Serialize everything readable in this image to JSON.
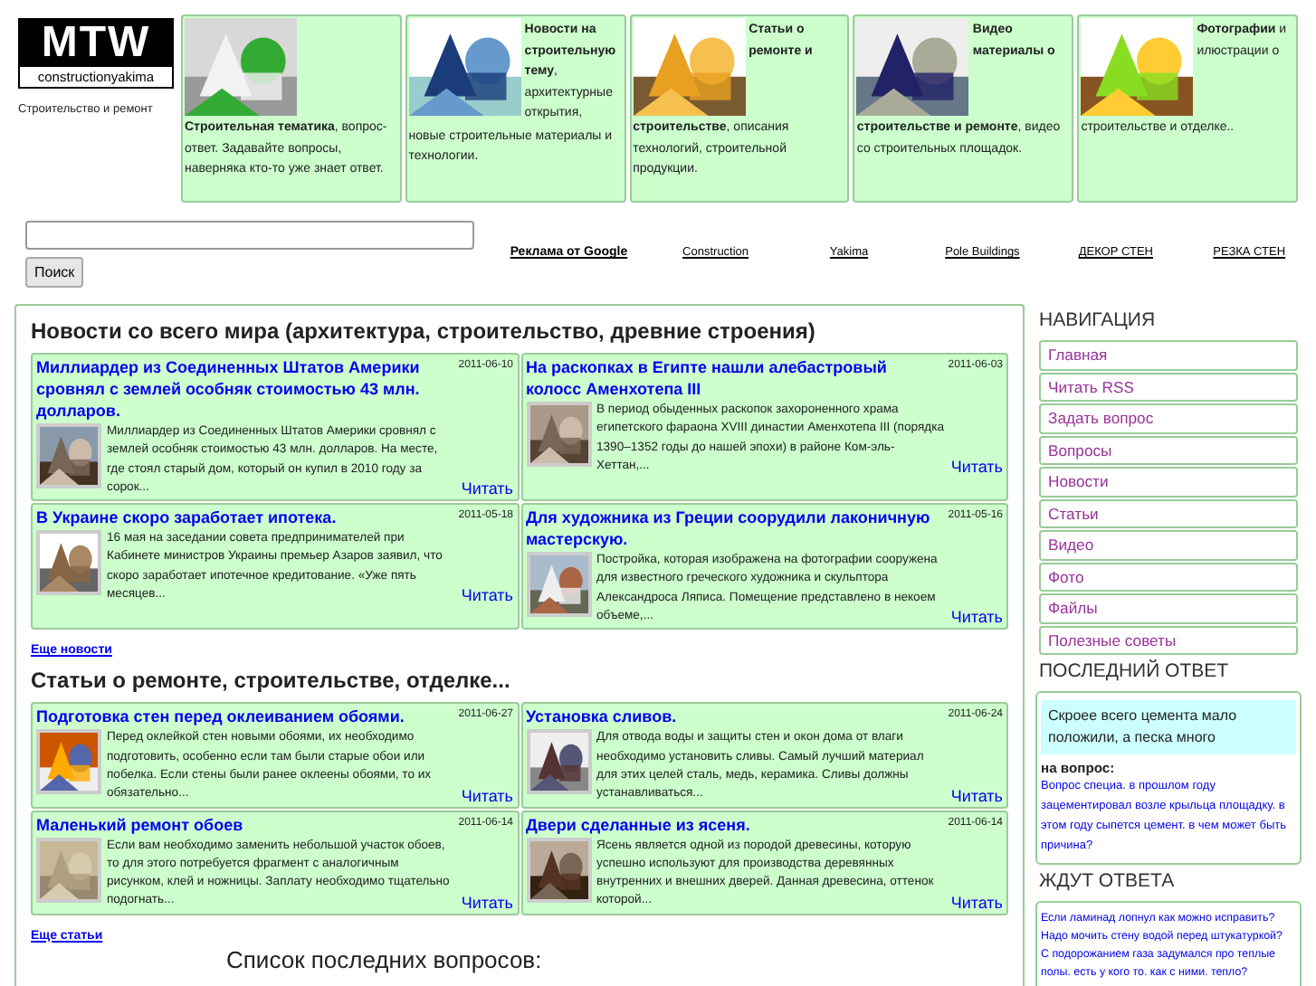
{
  "logo": {
    "mark": "MTW",
    "subtitle": "constructionyakima",
    "tagline": "Строительство и ремонт"
  },
  "tiles": [
    {
      "text": "**Строительная тематика**, вопрос-ответ. Задавайте вопросы, наверняка кто-то уже знает ответ."
    },
    {
      "head": "**Новости на строительную тему**, архитектурные открытия,",
      "text": "новые строительные материалы и технологии."
    },
    {
      "head": "**Статьи о ремонте и**",
      "text": "**строительстве**, описания технологий, строительной продукции."
    },
    {
      "head": "**Видео материалы о**",
      "text": "**строительстве и ремонте**, видео со строительных площадок."
    },
    {
      "head": "**Фотографии** и илюстрации о",
      "text": "строительстве и отделке.."
    }
  ],
  "search": {
    "button": "Поиск"
  },
  "ads": {
    "title": "Реклама от Google",
    "links": [
      "Construction",
      "Yakima",
      "Pole Buildings",
      "ДЕКОР СТЕН",
      "РЕЗКА СТЕН"
    ]
  },
  "sections": [
    {
      "heading": "Новости со всего мира (архитектура, строительство, древние строения)",
      "more": "Еще новости",
      "cards": [
        {
          "title": "Миллиардер из Соединенных Штатов Америки сровнял с землей особняк стоимостью 43 млн. долларов.",
          "date": "2011-06-10",
          "text": "Миллиардер из Соединенных Штатов Америки сровнял с землей особняк стоимостью 43 млн. долларов. На месте, где стоял старый дом, который он купил в 2010 году за сорок...",
          "read": "Читать"
        },
        {
          "title": "На раскопках в Египте нашли алебастровый колосс Аменхотепа III",
          "date": "2011-06-03",
          "text": "В период обыденных раскопок захороненного храма египетского фараона XVIII династии Аменхотепа III (порядка 1390–1352 годы до нашей эпохи) в районе Ком-эль-Хеттан,...",
          "read": "Читать"
        },
        {
          "title": "В Украине скоро заработает ипотека.",
          "date": "2011-05-18",
          "text": "16 мая на заседании совета предпринимателей при Кабинете министров Украины премьер Азаров заявил, что скоро заработает ипотечное кредитование. «Уже пять месяцев...",
          "read": "Читать"
        },
        {
          "title": "Для художника из Греции соорудили лаконичную мастерскую.",
          "date": "2011-05-16",
          "text": "Постройка, которая изображена на фотографии сооружена для известного греческого художника и скульптора Александроса Ляписа. Помещение представлено в некоем объеме,...",
          "read": "Читать"
        }
      ]
    },
    {
      "heading": "Статьи о ремонте, строительстве, отделке...",
      "more": "Еще статьи",
      "cards": [
        {
          "title": "Подготовка стен перед оклеиванием обоями.",
          "date": "2011-06-27",
          "text": "Перед оклейкой стен новыми обоями, их необходимо подготовить, особенно если там были старые обои или побелка. Если стены были ранее оклеены обоями, то их обязательно...",
          "read": "Читать"
        },
        {
          "title": "Установка сливов.",
          "date": "2011-06-24",
          "text": "Для отвода воды и защиты стен и окон дома от влаги необходимо установить сливы. Самый лучший материал для этих целей сталь, медь, керамика. Сливы должны устанавливаться...",
          "read": "Читать"
        },
        {
          "title": "Маленький ремонт обоев",
          "date": "2011-06-14",
          "text": "Если вам необходимо заменить небольшой участок обоев, то для этого потребуется фрагмент с аналогичным рисунком, клей и ножницы. Заплату необходимо тщательно подогнать...",
          "read": "Читать"
        },
        {
          "title": "Двери сделанные из ясеня.",
          "date": "2011-06-14",
          "text": "Ясень является одной из породой древесины, которую успешно используют для производства деревянных внутренних и внешних дверей. Данная древесина, оттенок которой...",
          "read": "Читать"
        }
      ]
    }
  ],
  "questions_heading": "Список последних вопросов:",
  "sidebar": {
    "nav_title": "НАВИГАЦИЯ",
    "nav": [
      "Главная",
      "Читать RSS",
      "Задать вопрос",
      "Вопросы",
      "Новости",
      "Статьи",
      "Видео",
      "Фото",
      "Файлы",
      "Полезные советы"
    ],
    "last_title": "ПОСЛЕДНИЙ ОТВЕТ",
    "answer": "Скроее всего цемента мало положили, а песка много",
    "question_label": "на вопрос:",
    "question": "Вопрос специа. в прошлом году зацементировал возле крыльца площадку. в этом году сыпется цемент. в чем может быть причина?",
    "wait_title": "ЖДУТ ОТВЕТА",
    "waiting": [
      "Если ламинад лопнул как можно исправить?",
      "Надо мочить стену водой перед штукатуркой?",
      "С подорожанием газа задумался про теплые полы. есть у кого то. как с ними. тепло?"
    ]
  }
}
